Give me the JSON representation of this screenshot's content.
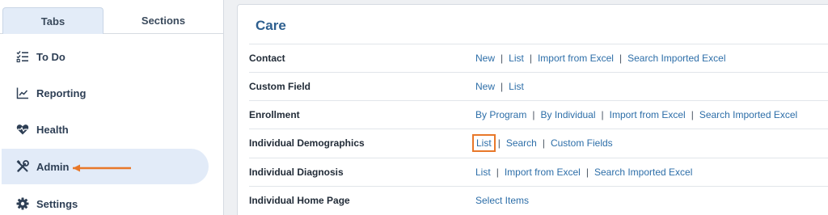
{
  "sidebar": {
    "tabs": [
      {
        "label": "Tabs",
        "active": true
      },
      {
        "label": "Sections",
        "active": false
      }
    ],
    "items": [
      {
        "label": "To Do",
        "icon": "checklist-icon"
      },
      {
        "label": "Reporting",
        "icon": "chart-line-icon"
      },
      {
        "label": "Health",
        "icon": "heart-pulse-icon"
      },
      {
        "label": "Admin",
        "icon": "tools-icon",
        "active": true
      },
      {
        "label": "Settings",
        "icon": "gear-icon"
      }
    ]
  },
  "panel": {
    "title": "Care",
    "rows": [
      {
        "label": "Contact",
        "links": [
          "New",
          "List",
          "Import from Excel",
          "Search Imported Excel"
        ]
      },
      {
        "label": "Custom Field",
        "links": [
          "New",
          "List"
        ]
      },
      {
        "label": "Enrollment",
        "links": [
          "By Program",
          "By Individual",
          "Import from Excel",
          "Search Imported Excel"
        ]
      },
      {
        "label": "Individual Demographics",
        "links": [
          "List",
          "Search",
          "Custom Fields"
        ],
        "highlighted_link": "List"
      },
      {
        "label": "Individual Diagnosis",
        "links": [
          "List",
          "Import from Excel",
          "Search Imported Excel"
        ]
      },
      {
        "label": "Individual Home Page",
        "links": [
          "Select Items"
        ]
      }
    ],
    "separator": "|"
  },
  "colors": {
    "accent": "#2d6ea8",
    "title": "#2d5f8f",
    "active_bg": "#e2ebf8",
    "annotation": "#e8782a"
  }
}
